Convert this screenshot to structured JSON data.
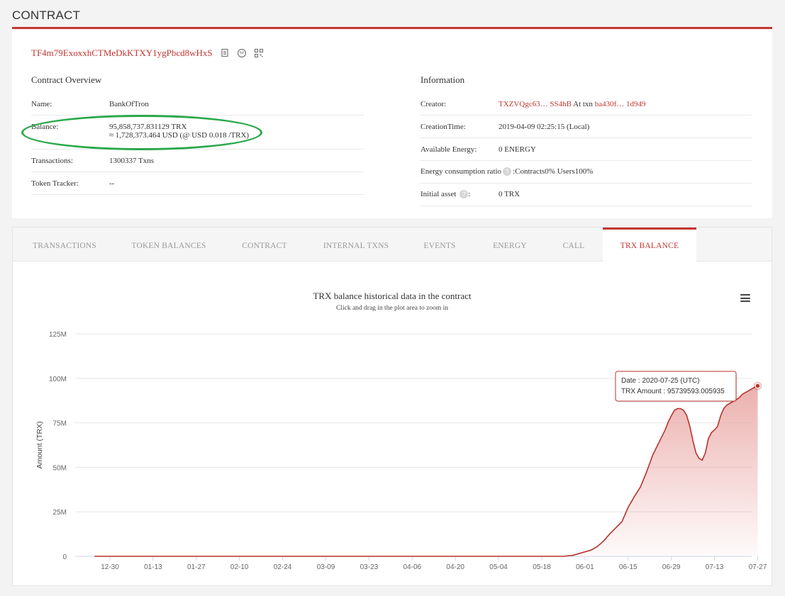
{
  "page_title": "CONTRACT",
  "address": "TF4m79ExoxxhCTMeDkKTXY1ygPbcd8wHxS",
  "overview": {
    "title": "Contract Overview",
    "name_label": "Name:",
    "name_value": "BankOfTron",
    "balance_label": "Balance:",
    "balance_trx": "95,858,737.831129 TRX",
    "balance_usd": "≈ 1,728,373.464 USD (@ USD 0.018 /TRX)",
    "transactions_label": "Transactions:",
    "transactions_value": "1300337  Txns",
    "token_tracker_label": "Token Tracker:",
    "token_tracker_value": "--"
  },
  "information": {
    "title": "Information",
    "creator_label": "Creator:",
    "creator_value": "TXZVQgc63… SS4hB",
    "creator_at": " At txn ",
    "creator_txn": "ba430f… 1d949",
    "creation_time_label": "CreationTime:",
    "creation_time_value": "2019-04-09 02:25:15 (Local)",
    "energy_label": "Available Energy:",
    "energy_value": "0  ENERGY",
    "ratio_label": "Energy consumption ratio",
    "ratio_value": ":Contracts0%  Users100%",
    "initial_label": "Initial asset",
    "initial_colon": ":",
    "initial_value": "0 TRX",
    "help_glyph": "?"
  },
  "tabs": [
    {
      "label": "TRANSACTIONS",
      "active": false
    },
    {
      "label": "TOKEN BALANCES",
      "active": false
    },
    {
      "label": "CONTRACT",
      "active": false
    },
    {
      "label": "INTERNAL TXNS",
      "active": false
    },
    {
      "label": "EVENTS",
      "active": false
    },
    {
      "label": "ENERGY",
      "active": false
    },
    {
      "label": "CALL",
      "active": false
    },
    {
      "label": "TRX BALANCE",
      "active": true
    }
  ],
  "colors": {
    "accent": "#c23631",
    "highlight_circle": "#2aa84a",
    "series_line": "#b8332e",
    "series_fill": "#e8a3a0"
  },
  "chart_data": {
    "type": "area",
    "title": "TRX balance historical data in the contract",
    "subtitle": "Click and drag in the plot area to zoom in",
    "ylabel": "Amount (TRX)",
    "xlabel": "",
    "ylim": [
      0,
      125000000
    ],
    "y_ticks": [
      0,
      25000000,
      50000000,
      75000000,
      100000000,
      125000000
    ],
    "y_tick_labels": [
      "0",
      "25M",
      "50M",
      "75M",
      "100M",
      "125M"
    ],
    "x_tick_labels": [
      "12-30",
      "01-13",
      "01-27",
      "02-10",
      "02-24",
      "03-09",
      "03-23",
      "04-06",
      "04-20",
      "05-04",
      "05-18",
      "06-01",
      "06-15",
      "06-29",
      "07-13",
      "07-27"
    ],
    "grid": true,
    "legend": "none",
    "series": [
      {
        "x": [
          -5,
          0,
          14,
          28,
          42,
          56,
          70,
          84,
          98,
          112,
          126,
          140,
          147,
          150,
          152,
          154,
          156,
          158,
          160,
          162,
          164,
          166,
          168,
          170,
          172,
          174,
          176,
          178,
          180,
          181,
          182,
          183,
          184,
          185,
          186,
          187,
          188,
          189,
          190,
          191,
          192,
          193,
          194,
          195,
          196,
          197,
          198,
          199,
          200,
          201,
          202,
          203,
          204,
          205,
          206,
          207,
          208,
          209,
          210
        ],
        "y": [
          0,
          0,
          0,
          0,
          0,
          0,
          0,
          0,
          0,
          0,
          0,
          0,
          0,
          500000,
          1500000,
          2500000,
          3500000,
          5500000,
          8500000,
          12500000,
          16000000,
          19500000,
          27500000,
          33500000,
          39000000,
          47500000,
          57000000,
          64000000,
          71000000,
          75500000,
          79000000,
          82000000,
          83000000,
          83000000,
          82000000,
          79000000,
          73000000,
          65000000,
          58000000,
          55000000,
          54000000,
          58000000,
          66000000,
          69500000,
          71000000,
          73000000,
          79000000,
          83000000,
          85000000,
          86000000,
          87000000,
          88000000,
          89000000,
          91000000,
          92000000,
          93000000,
          94000000,
          95000000,
          95739593
        ]
      }
    ],
    "tooltip": {
      "date_line": "Date : 2020-07-25 (UTC)",
      "amount_line": "TRX Amount : 95739593.005935"
    }
  }
}
